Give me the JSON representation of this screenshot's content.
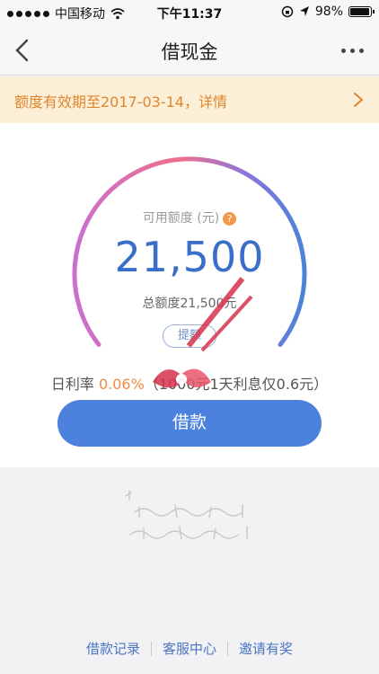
{
  "status_bar": {
    "carrier": "中国移动",
    "time": "下午11:37",
    "battery_percent": "98%",
    "battery_level": 0.98
  },
  "nav": {
    "title": "借现金"
  },
  "notice": {
    "text": "额度有效期至2017-03-14，详情"
  },
  "credit": {
    "available_label": "可用额度 (元)",
    "available_amount": "21,500",
    "total_label": "总额度21,500元",
    "raise_label": "提额"
  },
  "rate": {
    "prefix": "日利率 ",
    "value": "0.06%",
    "suffix": "（1000元1天利息仅0.6元）"
  },
  "borrow_label": "借款",
  "footer": {
    "records": "借款记录",
    "service": "客服中心",
    "invite": "邀请有奖"
  },
  "colors": {
    "primary": "#4c82dd",
    "amount": "#3a6fc9",
    "notice_bg": "#fcefd8",
    "notice_text": "#e0852b",
    "rate_value": "#f08c46"
  },
  "icons": {
    "back": "chevron-left",
    "more": "ellipsis-horizontal",
    "notice_arrow": "chevron-right",
    "help": "question-circle"
  }
}
